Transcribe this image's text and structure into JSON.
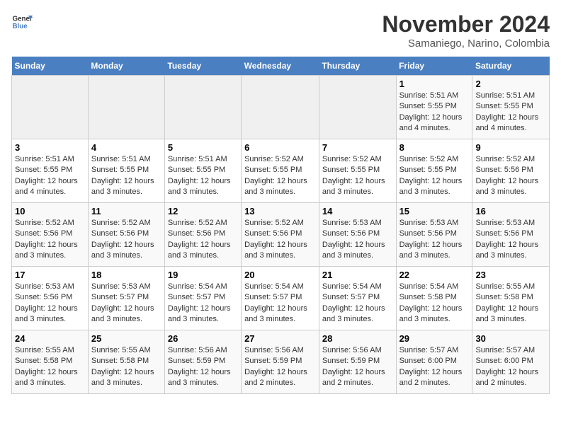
{
  "logo": {
    "line1": "General",
    "line2": "Blue"
  },
  "title": "November 2024",
  "location": "Samaniego, Narino, Colombia",
  "days_of_week": [
    "Sunday",
    "Monday",
    "Tuesday",
    "Wednesday",
    "Thursday",
    "Friday",
    "Saturday"
  ],
  "weeks": [
    [
      {
        "day": "",
        "info": ""
      },
      {
        "day": "",
        "info": ""
      },
      {
        "day": "",
        "info": ""
      },
      {
        "day": "",
        "info": ""
      },
      {
        "day": "",
        "info": ""
      },
      {
        "day": "1",
        "info": "Sunrise: 5:51 AM\nSunset: 5:55 PM\nDaylight: 12 hours and 4 minutes."
      },
      {
        "day": "2",
        "info": "Sunrise: 5:51 AM\nSunset: 5:55 PM\nDaylight: 12 hours and 4 minutes."
      }
    ],
    [
      {
        "day": "3",
        "info": "Sunrise: 5:51 AM\nSunset: 5:55 PM\nDaylight: 12 hours and 4 minutes."
      },
      {
        "day": "4",
        "info": "Sunrise: 5:51 AM\nSunset: 5:55 PM\nDaylight: 12 hours and 3 minutes."
      },
      {
        "day": "5",
        "info": "Sunrise: 5:51 AM\nSunset: 5:55 PM\nDaylight: 12 hours and 3 minutes."
      },
      {
        "day": "6",
        "info": "Sunrise: 5:52 AM\nSunset: 5:55 PM\nDaylight: 12 hours and 3 minutes."
      },
      {
        "day": "7",
        "info": "Sunrise: 5:52 AM\nSunset: 5:55 PM\nDaylight: 12 hours and 3 minutes."
      },
      {
        "day": "8",
        "info": "Sunrise: 5:52 AM\nSunset: 5:55 PM\nDaylight: 12 hours and 3 minutes."
      },
      {
        "day": "9",
        "info": "Sunrise: 5:52 AM\nSunset: 5:56 PM\nDaylight: 12 hours and 3 minutes."
      }
    ],
    [
      {
        "day": "10",
        "info": "Sunrise: 5:52 AM\nSunset: 5:56 PM\nDaylight: 12 hours and 3 minutes."
      },
      {
        "day": "11",
        "info": "Sunrise: 5:52 AM\nSunset: 5:56 PM\nDaylight: 12 hours and 3 minutes."
      },
      {
        "day": "12",
        "info": "Sunrise: 5:52 AM\nSunset: 5:56 PM\nDaylight: 12 hours and 3 minutes."
      },
      {
        "day": "13",
        "info": "Sunrise: 5:52 AM\nSunset: 5:56 PM\nDaylight: 12 hours and 3 minutes."
      },
      {
        "day": "14",
        "info": "Sunrise: 5:53 AM\nSunset: 5:56 PM\nDaylight: 12 hours and 3 minutes."
      },
      {
        "day": "15",
        "info": "Sunrise: 5:53 AM\nSunset: 5:56 PM\nDaylight: 12 hours and 3 minutes."
      },
      {
        "day": "16",
        "info": "Sunrise: 5:53 AM\nSunset: 5:56 PM\nDaylight: 12 hours and 3 minutes."
      }
    ],
    [
      {
        "day": "17",
        "info": "Sunrise: 5:53 AM\nSunset: 5:56 PM\nDaylight: 12 hours and 3 minutes."
      },
      {
        "day": "18",
        "info": "Sunrise: 5:53 AM\nSunset: 5:57 PM\nDaylight: 12 hours and 3 minutes."
      },
      {
        "day": "19",
        "info": "Sunrise: 5:54 AM\nSunset: 5:57 PM\nDaylight: 12 hours and 3 minutes."
      },
      {
        "day": "20",
        "info": "Sunrise: 5:54 AM\nSunset: 5:57 PM\nDaylight: 12 hours and 3 minutes."
      },
      {
        "day": "21",
        "info": "Sunrise: 5:54 AM\nSunset: 5:57 PM\nDaylight: 12 hours and 3 minutes."
      },
      {
        "day": "22",
        "info": "Sunrise: 5:54 AM\nSunset: 5:58 PM\nDaylight: 12 hours and 3 minutes."
      },
      {
        "day": "23",
        "info": "Sunrise: 5:55 AM\nSunset: 5:58 PM\nDaylight: 12 hours and 3 minutes."
      }
    ],
    [
      {
        "day": "24",
        "info": "Sunrise: 5:55 AM\nSunset: 5:58 PM\nDaylight: 12 hours and 3 minutes."
      },
      {
        "day": "25",
        "info": "Sunrise: 5:55 AM\nSunset: 5:58 PM\nDaylight: 12 hours and 3 minutes."
      },
      {
        "day": "26",
        "info": "Sunrise: 5:56 AM\nSunset: 5:59 PM\nDaylight: 12 hours and 3 minutes."
      },
      {
        "day": "27",
        "info": "Sunrise: 5:56 AM\nSunset: 5:59 PM\nDaylight: 12 hours and 2 minutes."
      },
      {
        "day": "28",
        "info": "Sunrise: 5:56 AM\nSunset: 5:59 PM\nDaylight: 12 hours and 2 minutes."
      },
      {
        "day": "29",
        "info": "Sunrise: 5:57 AM\nSunset: 6:00 PM\nDaylight: 12 hours and 2 minutes."
      },
      {
        "day": "30",
        "info": "Sunrise: 5:57 AM\nSunset: 6:00 PM\nDaylight: 12 hours and 2 minutes."
      }
    ]
  ]
}
